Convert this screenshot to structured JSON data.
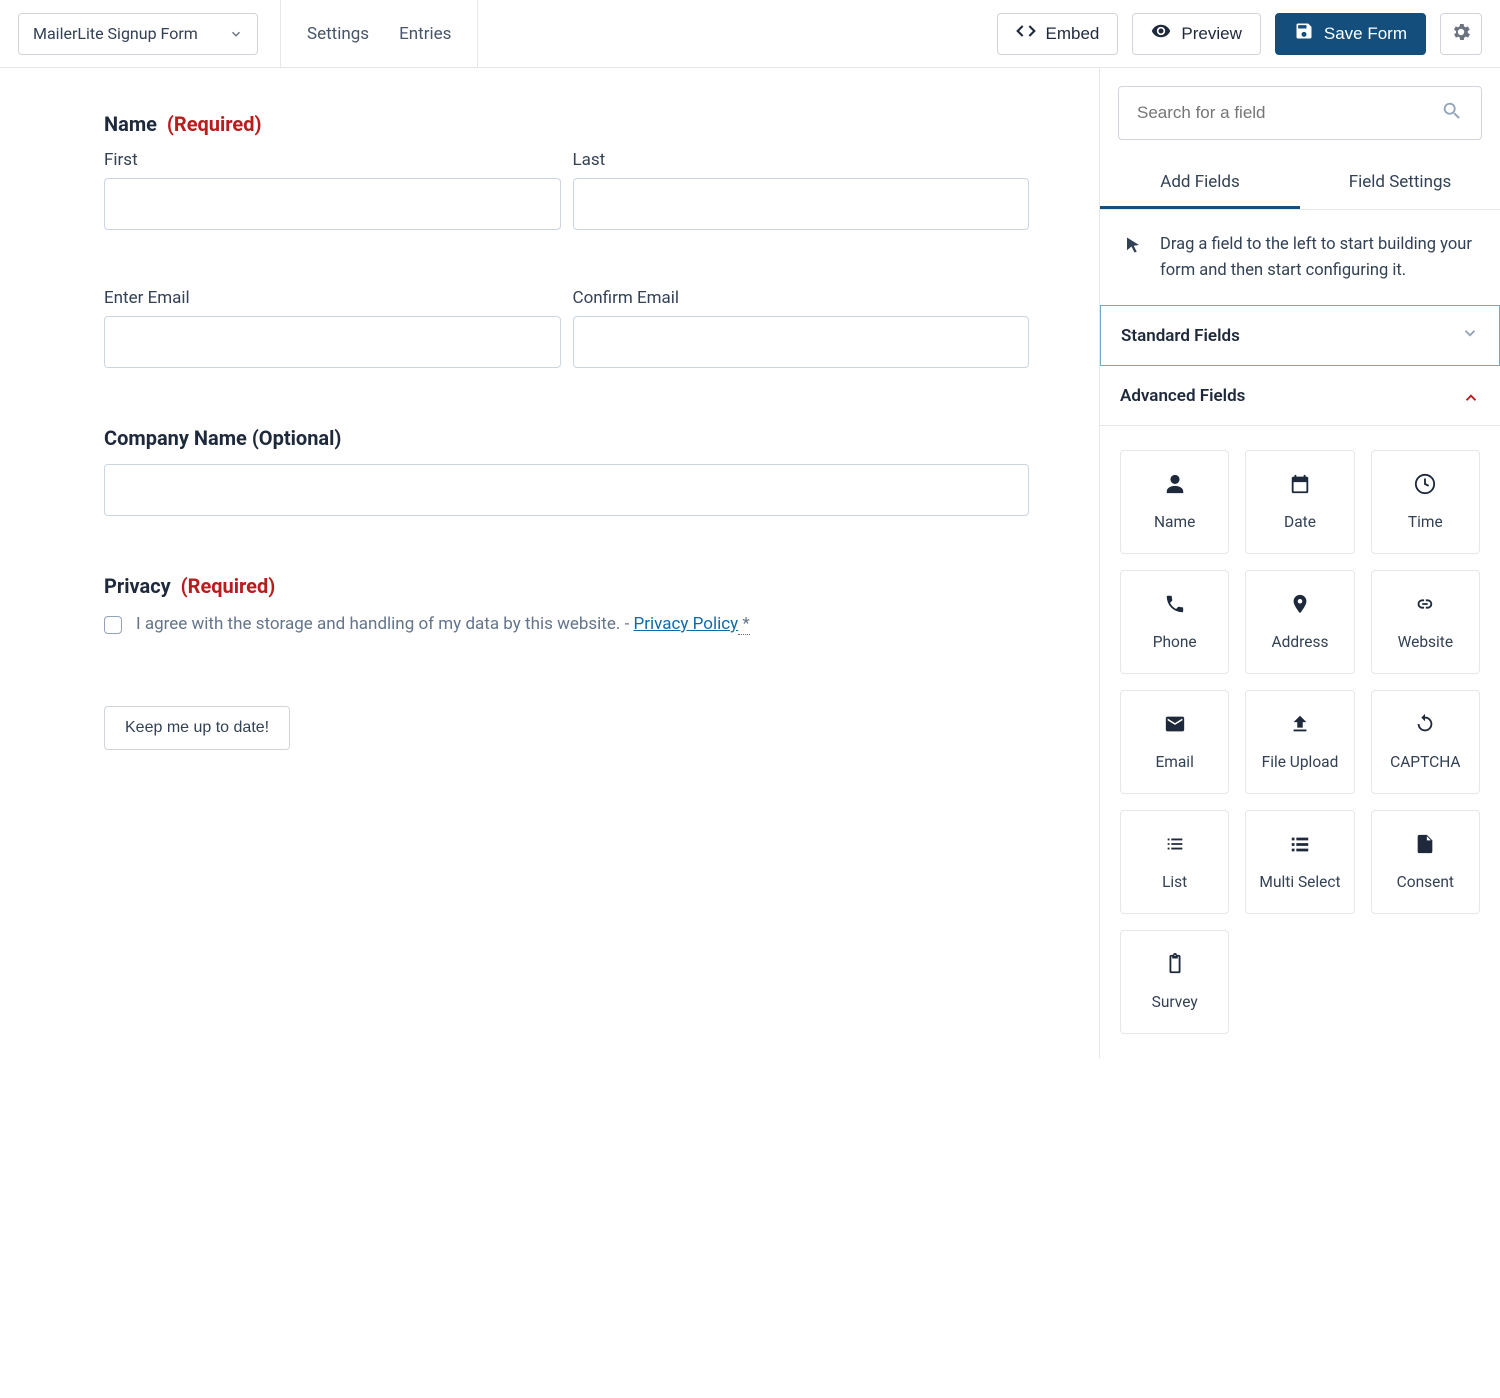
{
  "header": {
    "form_name": "MailerLite Signup Form",
    "nav": {
      "settings": "Settings",
      "entries": "Entries"
    },
    "buttons": {
      "embed": "Embed",
      "preview": "Preview",
      "save": "Save Form"
    }
  },
  "form": {
    "name_label": "Name",
    "required_tag": "(Required)",
    "first_label": "First",
    "last_label": "Last",
    "enter_email_label": "Enter Email",
    "confirm_email_label": "Confirm Email",
    "company_label": "Company Name (Optional)",
    "privacy_label": "Privacy",
    "privacy_text_1": "I agree with the storage and handling of my data by this website. - ",
    "privacy_link": "Privacy Policy",
    "privacy_asterisk": " *",
    "submit_label": "Keep me up to date!"
  },
  "sidebar": {
    "search_placeholder": "Search for a field",
    "tabs": {
      "add": "Add Fields",
      "settings": "Field Settings"
    },
    "hint": "Drag a field to the left to start building your form and then start configuring it.",
    "sections": {
      "standard": "Standard Fields",
      "advanced": "Advanced Fields"
    },
    "advanced_fields": [
      {
        "name": "Name",
        "icon": "person"
      },
      {
        "name": "Date",
        "icon": "calendar"
      },
      {
        "name": "Time",
        "icon": "clock"
      },
      {
        "name": "Phone",
        "icon": "phone"
      },
      {
        "name": "Address",
        "icon": "pin"
      },
      {
        "name": "Website",
        "icon": "link"
      },
      {
        "name": "Email",
        "icon": "mail"
      },
      {
        "name": "File Upload",
        "icon": "upload"
      },
      {
        "name": "CAPTCHA",
        "icon": "refresh"
      },
      {
        "name": "List",
        "icon": "list"
      },
      {
        "name": "Multi Select",
        "icon": "multiselect"
      },
      {
        "name": "Consent",
        "icon": "file"
      },
      {
        "name": "Survey",
        "icon": "clipboard"
      }
    ]
  }
}
